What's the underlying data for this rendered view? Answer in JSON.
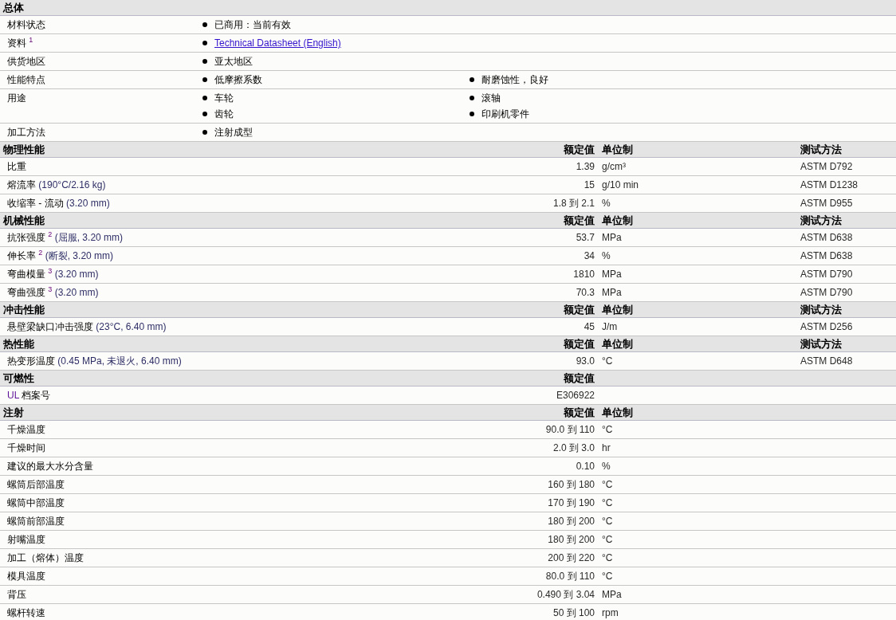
{
  "sections": [
    {
      "kind": "general",
      "title": "总体",
      "rows": [
        {
          "label": "材料状态",
          "items": [
            {
              "kind": "text",
              "text": "已商用：当前有效"
            }
          ]
        },
        {
          "label": "资料",
          "note": "1",
          "items": [
            {
              "kind": "link",
              "text": "Technical Datasheet (English)"
            }
          ]
        },
        {
          "label": "供货地区",
          "items": [
            {
              "kind": "text",
              "text": "亚太地区"
            }
          ]
        },
        {
          "label": "性能特点",
          "items": [
            {
              "kind": "text",
              "text": "低摩擦系数"
            },
            {
              "kind": "text",
              "text": "耐磨蚀性，良好"
            }
          ]
        },
        {
          "label": "用途",
          "items": [
            {
              "kind": "text",
              "text": "车轮"
            },
            {
              "kind": "text",
              "text": "滚轴"
            },
            {
              "kind": "text",
              "text": "齿轮"
            },
            {
              "kind": "text",
              "text": "印刷机零件"
            }
          ]
        },
        {
          "label": "加工方法",
          "items": [
            {
              "kind": "text",
              "text": "注射成型"
            }
          ]
        }
      ]
    },
    {
      "kind": "property",
      "title": "物理性能",
      "headings": {
        "value": "额定值",
        "unit": "单位制",
        "method": "测试方法"
      },
      "rows": [
        {
          "label": "比重",
          "value": "1.39",
          "unit": "g/cm³",
          "method": "ASTM D792"
        },
        {
          "label": "熔流率",
          "condition": "(190°C/2.16 kg)",
          "value": "15",
          "unit": "g/10 min",
          "method": "ASTM D1238"
        },
        {
          "label": "收缩率 - 流动",
          "condition": "(3.20 mm)",
          "value": "1.8 到 2.1",
          "unit": "%",
          "method": "ASTM D955"
        }
      ]
    },
    {
      "kind": "property",
      "title": "机械性能",
      "headings": {
        "value": "额定值",
        "unit": "单位制",
        "method": "测试方法"
      },
      "rows": [
        {
          "label": "抗张强度",
          "note": "2",
          "condition": "(屈服, 3.20 mm)",
          "value": "53.7",
          "unit": "MPa",
          "method": "ASTM D638"
        },
        {
          "label": "伸长率",
          "note": "2",
          "condition": "(断裂, 3.20 mm)",
          "value": "34",
          "unit": "%",
          "method": "ASTM D638"
        },
        {
          "label": "弯曲模量",
          "note": "3",
          "condition": "(3.20 mm)",
          "value": "1810",
          "unit": "MPa",
          "method": "ASTM D790"
        },
        {
          "label": "弯曲强度",
          "note": "3",
          "condition": "(3.20 mm)",
          "value": "70.3",
          "unit": "MPa",
          "method": "ASTM D790"
        }
      ]
    },
    {
      "kind": "property",
      "title": "冲击性能",
      "headings": {
        "value": "额定值",
        "unit": "单位制",
        "method": "测试方法"
      },
      "rows": [
        {
          "label": "悬壁梁缺口冲击强度",
          "condition": "(23°C, 6.40 mm)",
          "value": "45",
          "unit": "J/m",
          "method": "ASTM D256"
        }
      ]
    },
    {
      "kind": "property",
      "title": "热性能",
      "headings": {
        "value": "额定值",
        "unit": "单位制",
        "method": "测试方法"
      },
      "rows": [
        {
          "label": "热变形温度",
          "condition": "(0.45 MPa, 未退火, 6.40 mm)",
          "value": "93.0",
          "unit": "°C",
          "method": "ASTM D648"
        }
      ]
    },
    {
      "kind": "property",
      "title": "可燃性",
      "headings": {
        "value": "额定值"
      },
      "rows": [
        {
          "prefix": "UL",
          "label": "档案号",
          "value": "E306922"
        }
      ]
    },
    {
      "kind": "property",
      "title": "注射",
      "headings": {
        "value": "额定值",
        "unit": "单位制"
      },
      "rows": [
        {
          "label": "千燥温度",
          "value": "90.0 到 110",
          "unit": "°C"
        },
        {
          "label": "千燥时间",
          "value": "2.0 到 3.0",
          "unit": "hr"
        },
        {
          "label": "建议的最大水分含量",
          "value": "0.10",
          "unit": "%"
        },
        {
          "label": "螺筒后部温度",
          "value": "160 到 180",
          "unit": "°C"
        },
        {
          "label": "螺筒中部温度",
          "value": "170 到 190",
          "unit": "°C"
        },
        {
          "label": "螺筒前部温度",
          "value": "180 到 200",
          "unit": "°C"
        },
        {
          "label": "射嘴温度",
          "value": "180 到 200",
          "unit": "°C"
        },
        {
          "label": "加工（熔体）温度",
          "value": "200 到 220",
          "unit": "°C"
        },
        {
          "label": "模具温度",
          "value": "80.0 到 110",
          "unit": "°C"
        },
        {
          "label": "背压",
          "value": "0.490 到 3.04",
          "unit": "MPa"
        },
        {
          "label": "螺杆转速",
          "value": "50 到 100",
          "unit": "rpm"
        }
      ]
    }
  ]
}
